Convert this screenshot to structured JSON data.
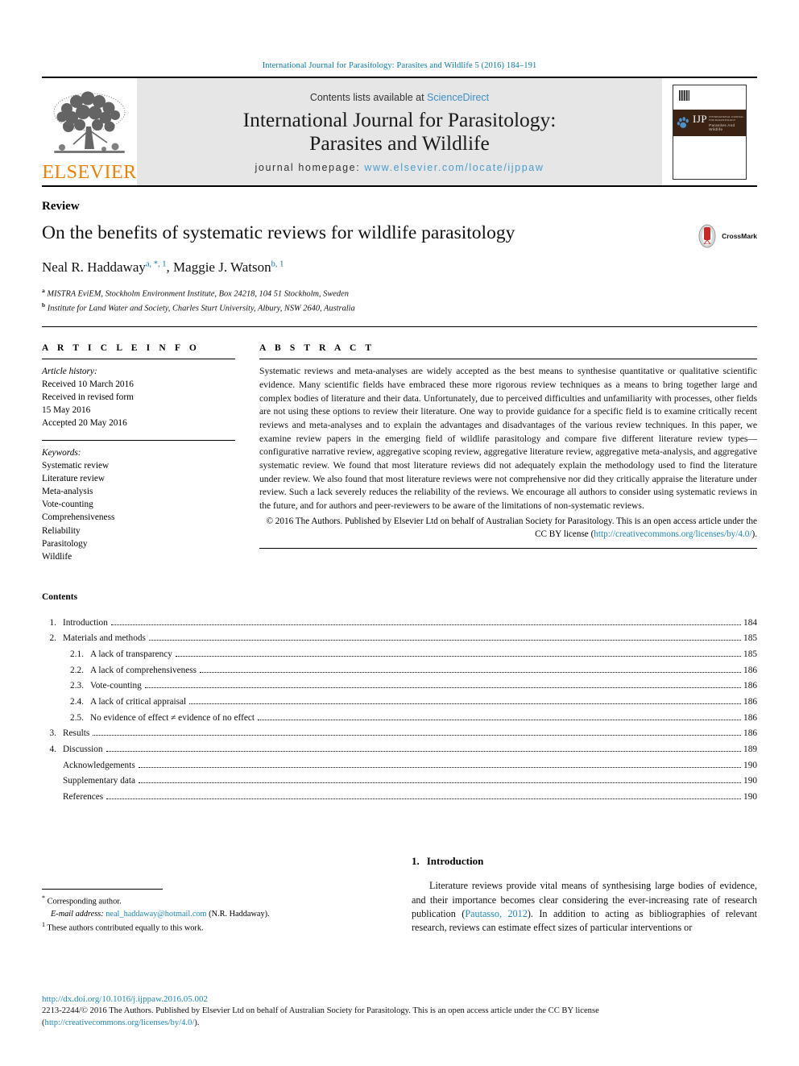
{
  "running_head": "International Journal for Parasitology: Parasites and Wildlife 5 (2016) 184–191",
  "masthead": {
    "publisher_logo_text": "ELSEVIER",
    "contents_prefix": "Contents lists available at ",
    "contents_link": "ScienceDirect",
    "journal_title_line1": "International Journal for Parasitology:",
    "journal_title_line2": "Parasites and Wildlife",
    "homepage_prefix": "journal homepage:",
    "homepage_url": "www.elsevier.com/locate/ijppaw",
    "cover_ijp": "IJP",
    "cover_sub": "INTERNATIONAL JOURNAL FOR PARASITOLOGY",
    "cover_tagline": "Parasites And Wildlife"
  },
  "article": {
    "type": "Review",
    "title": "On the benefits of systematic reviews for wildlife parasitology",
    "crossmark_label": "CrossMark",
    "authors": [
      {
        "name": "Neal R. Haddaway",
        "marks": "a, *, 1"
      },
      {
        "name": "Maggie J. Watson",
        "marks": "b, 1"
      }
    ],
    "authors_separator": ", ",
    "affiliations": [
      {
        "mark": "a",
        "text": "MISTRA EviEM, Stockholm Environment Institute, Box 24218, 104 51 Stockholm, Sweden"
      },
      {
        "mark": "b",
        "text": "Institute for Land Water and Society, Charles Sturt University, Albury, NSW 2640, Australia"
      }
    ]
  },
  "article_info": {
    "heading": "A R T I C L E   I N F O",
    "history_label": "Article history:",
    "history": [
      "Received 10 March 2016",
      "Received in revised form",
      "15 May 2016",
      "Accepted 20 May 2016"
    ],
    "keywords_label": "Keywords:",
    "keywords": [
      "Systematic review",
      "Literature review",
      "Meta-analysis",
      "Vote-counting",
      "Comprehensiveness",
      "Reliability",
      "Parasitology",
      "Wildlife"
    ]
  },
  "abstract": {
    "heading": "A B S T R A C T",
    "body": "Systematic reviews and meta-analyses are widely accepted as the best means to synthesise quantitative or qualitative scientific evidence. Many scientific fields have embraced these more rigorous review techniques as a means to bring together large and complex bodies of literature and their data. Unfortunately, due to perceived difficulties and unfamiliarity with processes, other fields are not using these options to review their literature. One way to provide guidance for a specific field is to examine critically recent reviews and meta-analyses and to explain the advantages and disadvantages of the various review techniques. In this paper, we examine review papers in the emerging field of wildlife parasitology and compare five different literature review types—configurative narrative review, aggregative scoping review, aggregative literature review, aggregative meta-analysis, and aggregative systematic review. We found that most literature reviews did not adequately explain the methodology used to find the literature under review. We also found that most literature reviews were not comprehensive nor did they critically appraise the literature under review. Such a lack severely reduces the reliability of the reviews. We encourage all authors to consider using systematic reviews in the future, and for authors and peer-reviewers to be aware of the limitations of non-systematic reviews.",
    "copyright_prefix": "© 2016 The Authors. Published by Elsevier Ltd on behalf of Australian Society for Parasitology. This is an open access article under the CC BY license (",
    "copyright_link": "http://creativecommons.org/licenses/by/4.0/",
    "copyright_suffix": ")."
  },
  "contents": {
    "heading": "Contents",
    "items": [
      {
        "num": "1.",
        "label": "Introduction",
        "page": "184",
        "level": 1
      },
      {
        "num": "2.",
        "label": "Materials and methods",
        "page": "185",
        "level": 1
      },
      {
        "num": "2.1.",
        "label": "A lack of transparency",
        "page": "185",
        "level": 2
      },
      {
        "num": "2.2.",
        "label": "A lack of comprehensiveness",
        "page": "186",
        "level": 2
      },
      {
        "num": "2.3.",
        "label": "Vote-counting",
        "page": "186",
        "level": 2
      },
      {
        "num": "2.4.",
        "label": "A lack of critical appraisal",
        "page": "186",
        "level": 2
      },
      {
        "num": "2.5.",
        "label": "No evidence of effect ≠ evidence of no effect",
        "page": "186",
        "level": 2
      },
      {
        "num": "3.",
        "label": "Results",
        "page": "186",
        "level": 1
      },
      {
        "num": "4.",
        "label": "Discussion",
        "page": "189",
        "level": 1
      },
      {
        "num": "",
        "label": "Acknowledgements",
        "page": "190",
        "level": 3
      },
      {
        "num": "",
        "label": "Supplementary data",
        "page": "190",
        "level": 3
      },
      {
        "num": "",
        "label": "References",
        "page": "190",
        "level": 3
      }
    ]
  },
  "introduction": {
    "number": "1.",
    "heading": "Introduction",
    "paragraph_part1": "Literature reviews provide vital means of synthesising large bodies of evidence, and their importance becomes clear considering the ever-increasing rate of research publication (",
    "citation": "Pautasso, 2012",
    "paragraph_part2": "). In addition to acting as bibliographies of relevant research, reviews can estimate effect sizes of particular interventions or"
  },
  "footnotes": {
    "corresponding": "Corresponding author.",
    "email_label": "E-mail address:",
    "email": "neal_haddaway@hotmail.com",
    "email_suffix": "(N.R. Haddaway).",
    "equal_contribution": "These authors contributed equally to this work."
  },
  "page_footer": {
    "doi": "http://dx.doi.org/10.1016/j.ijppaw.2016.05.002",
    "issn_line_prefix": "2213-2244/© 2016 The Authors. Published by Elsevier Ltd on behalf of Australian Society for Parasitology. This is an open access article under the CC BY license (",
    "issn_link": "http://creativecommons.org/licenses/by/4.0/",
    "issn_suffix": ")."
  },
  "colors": {
    "link_blue": "#1f86bd",
    "header_blue": "#0a7ab0",
    "elsevier_orange": "#f08000",
    "masthead_grey": "#e6e6e6",
    "cover_brown": "#3b2314"
  }
}
